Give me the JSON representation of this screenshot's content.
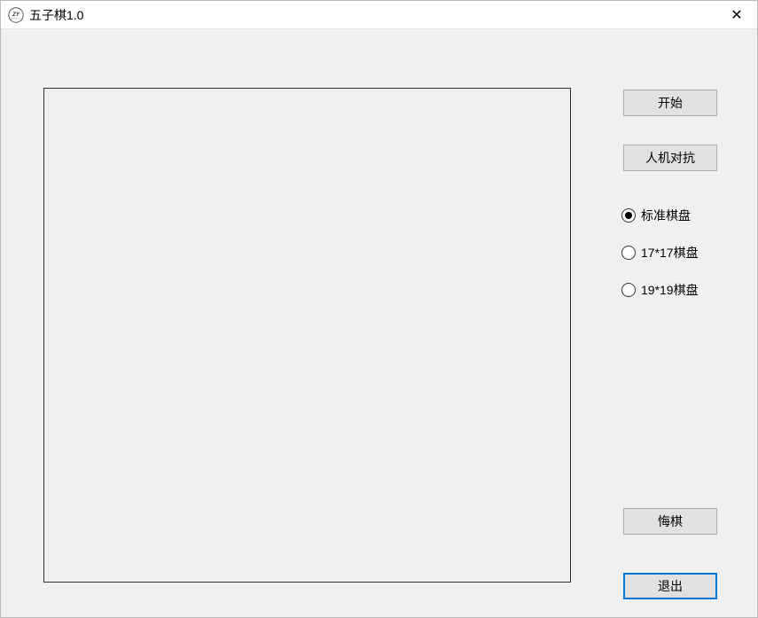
{
  "window": {
    "title": "五子棋1.0"
  },
  "buttons": {
    "start": "开始",
    "mode": "人机对抗",
    "undo": "悔棋",
    "exit": "退出"
  },
  "boardSizeOptions": {
    "standard": {
      "label": "标准棋盘",
      "selected": true
    },
    "size17": {
      "label": "17*17棋盘",
      "selected": false
    },
    "size19": {
      "label": "19*19棋盘",
      "selected": false
    }
  }
}
